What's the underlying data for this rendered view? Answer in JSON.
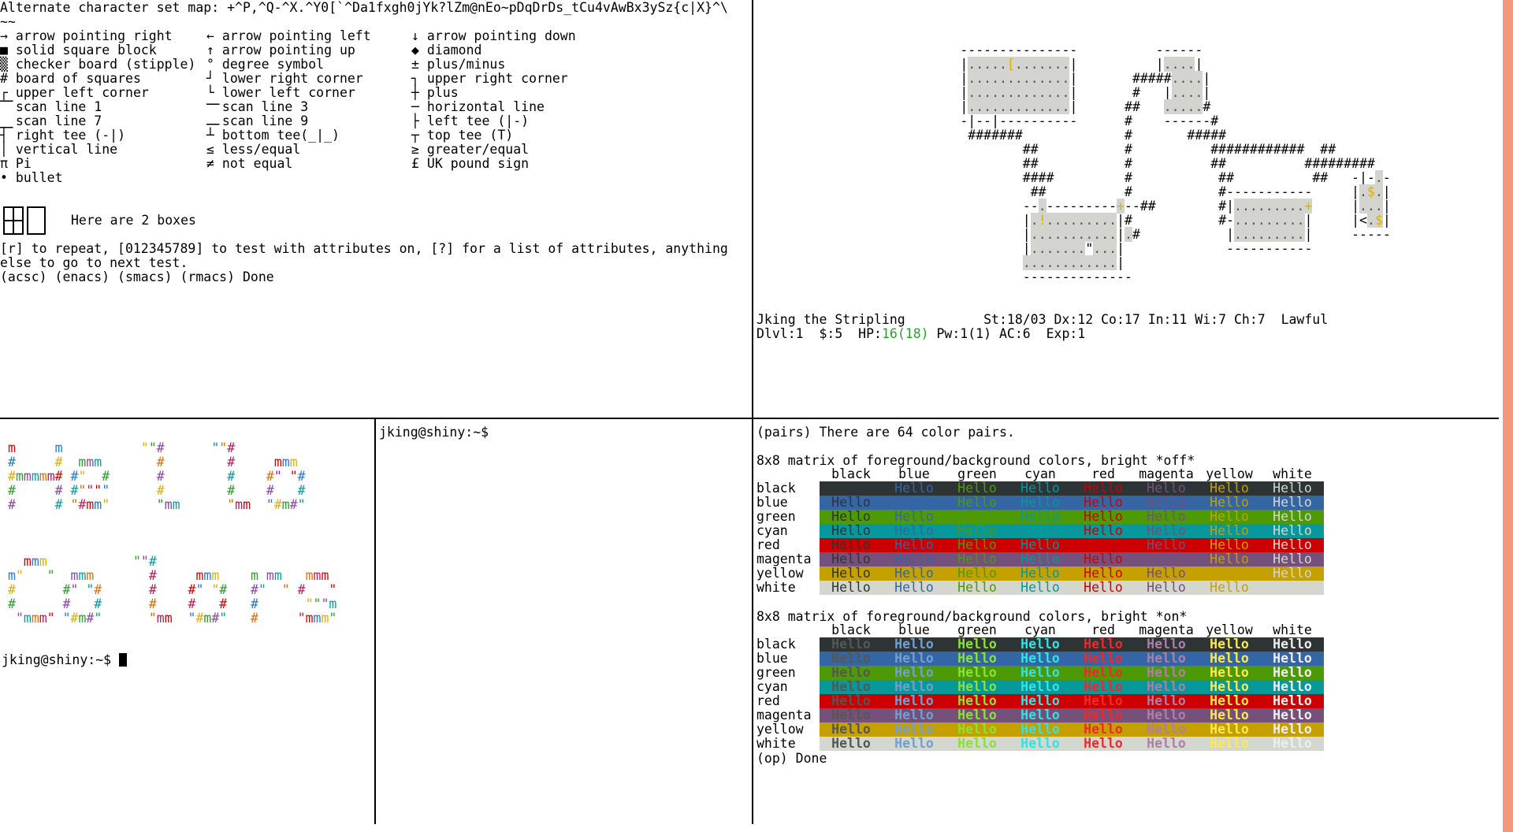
{
  "acs_pane": {
    "header": "Alternate character set map: +^P,^Q-^X.^Y0[`^Da1fxg\nh0jYk?lZm@nEo~pDqDrDs_tCu4vAwBx3ySz{c|X}^\\",
    "header_line1": "Alternate character set map: +^P,^Q-^X.^Y0[`^Da1fxgh0jYk?lZm@nEo~pDqDrDs_tCu4vAwBx3ySz{c|X}^\\",
    "header_line2": "~~",
    "col1": [
      {
        "glyph": "→",
        "label": "arrow pointing right"
      },
      {
        "glyph": "■",
        "label": "solid square block"
      },
      {
        "glyph": "▒",
        "label": "checker board (stipple)"
      },
      {
        "glyph": "#",
        "label": "board of squares"
      },
      {
        "glyph": "┌",
        "label": "upper left corner"
      },
      {
        "glyph": "⎺",
        "label": "scan line 1"
      },
      {
        "glyph": "⎽",
        "label": "scan line 7"
      },
      {
        "glyph": "┤",
        "label": "right tee (-|)"
      },
      {
        "glyph": "│",
        "label": "vertical line"
      },
      {
        "glyph": "π",
        "label": "Pi"
      },
      {
        "glyph": "•",
        "label": "bullet"
      }
    ],
    "col2": [
      {
        "glyph": "←",
        "label": "arrow pointing left"
      },
      {
        "glyph": "↑",
        "label": "arrow pointing up"
      },
      {
        "glyph": "°",
        "label": "degree symbol"
      },
      {
        "glyph": "┘",
        "label": "lower right corner"
      },
      {
        "glyph": "└",
        "label": "lower left corner"
      },
      {
        "glyph": "⎻",
        "label": "scan line 3"
      },
      {
        "glyph": "⎼",
        "label": "scan line 9"
      },
      {
        "glyph": "┴",
        "label": "bottom tee(_|_)"
      },
      {
        "glyph": "≤",
        "label": "less/equal"
      },
      {
        "glyph": "≠",
        "label": "not equal"
      }
    ],
    "col3": [
      {
        "glyph": "↓",
        "label": "arrow pointing down"
      },
      {
        "glyph": "◆",
        "label": "diamond"
      },
      {
        "glyph": "±",
        "label": "plus/minus"
      },
      {
        "glyph": "┐",
        "label": "upper right corner"
      },
      {
        "glyph": "┼",
        "label": "plus"
      },
      {
        "glyph": "─",
        "label": "horizontal line"
      },
      {
        "glyph": "├",
        "label": "left tee (|-)"
      },
      {
        "glyph": "┬",
        "label": "top tee (T)"
      },
      {
        "glyph": "≥",
        "label": "greater/equal"
      },
      {
        "glyph": "£",
        "label": "UK pound sign"
      }
    ],
    "boxes_text": "Here are 2 boxes",
    "prompt_line1": "[r] to repeat, [012345789] to test with attributes on, [?] for a list of attributes, anything",
    "prompt_line2": "else to go to next test.",
    "done_line": "(acsc) (enacs) (smacs) (rmacs) Done"
  },
  "game_pane": {
    "map_rows": [
      "          ---------------          ------",
      "          |.....[.......|          |....|",
      "          |.............|       #####....|",
      "          |.............|       #   |....|",
      "          |.............|      ##   .....#",
      "          -|--|----------      #    ------#",
      "           #######             #       #####",
      "                  ##           #          ############  ##",
      "                  ##           #          ##          #########",
      "                  ####         #           ##          ##   -|-.-",
      "                   ##          #           #-----------     |.$.|",
      "                  --.---------+--##        #|.........+     |...|",
      "                  |.!.........|#           #-.........|     |<.$|",
      "                  |...........|.#           |.........|     -----",
      "                  |.......\"...|             -----------",
      "                  ............|",
      "                  --------------"
    ],
    "status_line1": "Jking the Stripling          St:18/03 Dx:12 Co:17 In:11 Wi:7 Ch:7  Lawful",
    "status_dlvl": "Dlvl:1  $:5  HP:",
    "status_hp": "16(18)",
    "status_rest": " Pw:1(1) AC:6  Exp:1"
  },
  "hello_pane": {
    "prompt_top": "jking@shiny:~$",
    "prompt_bottom": "jking@shiny:~$ "
  },
  "shell_pane": {
    "prompt": "jking@shiny:~$"
  },
  "colors_pane": {
    "pairs_line": "(pairs) There are 64 color pairs.",
    "matrix1_title": "8x8 matrix of foreground/background colors, bright *off*",
    "matrix2_title": "8x8 matrix of foreground/background colors, bright *on*",
    "color_names": [
      "black",
      "blue",
      "green",
      "cyan",
      "red",
      "magenta",
      "yellow",
      "white"
    ],
    "cell_text": "Hello",
    "done_line": "(op) Done",
    "bg_colors": [
      "#2e3436",
      "#3465a4",
      "#4e9a06",
      "#06989a",
      "#cc0000",
      "#75507b",
      "#c4a000",
      "#d3d7cf"
    ],
    "fg_dim": [
      "#2e3436",
      "#3465a4",
      "#4e9a06",
      "#06989a",
      "#cc0000",
      "#75507b",
      "#c4a000",
      "#d3d7cf"
    ],
    "fg_bright": [
      "#555753",
      "#729fcf",
      "#8ae234",
      "#34e2e2",
      "#ef2929",
      "#ad7fa8",
      "#fce94f",
      "#eeeeec"
    ]
  },
  "colors": {
    "accent_strip": "#f2967d",
    "hp_green": "#2aa12a",
    "gold": "#e0b000"
  }
}
